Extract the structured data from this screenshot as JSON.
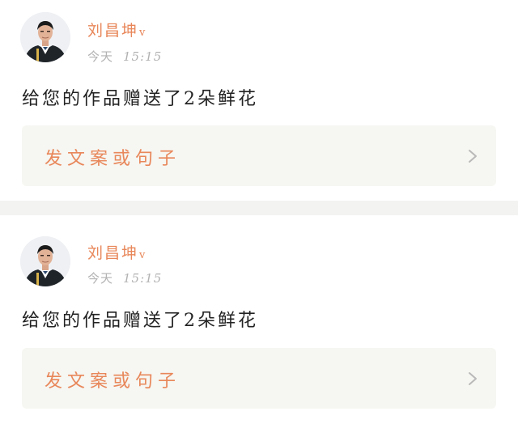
{
  "accent_color": "#e8875a",
  "posts": [
    {
      "username": "刘昌坤",
      "verified_badge": "v",
      "date_label": "今天",
      "time": "15:15",
      "message": "给您的作品赠送了2朵鲜花",
      "action_label": "发文案或句子",
      "action_icon": "chevron-right-icon"
    },
    {
      "username": "刘昌坤",
      "verified_badge": "v",
      "date_label": "今天",
      "time": "15:15",
      "message": "给您的作品赠送了2朵鲜花",
      "action_label": "发文案或句子",
      "action_icon": "chevron-right-icon"
    }
  ]
}
